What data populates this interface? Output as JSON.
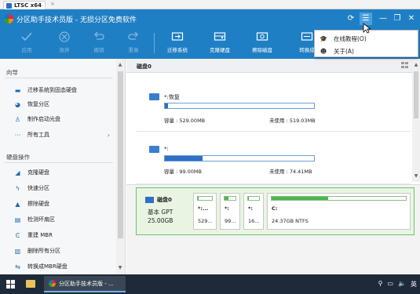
{
  "vm": {
    "tab_label": "LTSC x64",
    "tab_close": "×"
  },
  "window": {
    "title": "分区助手技术员版 - 无损分区免费软件",
    "buttons": {
      "refresh": "⟳",
      "menu": "☰",
      "minimize": "—",
      "maximize": "❐",
      "close": "✕"
    }
  },
  "toolbar": {
    "apply": "应用",
    "discard": "放弃",
    "undo": "撤销",
    "redo": "重做",
    "migrate": "迁移系统",
    "clone_disk": "克隆硬盘",
    "wipe_disk": "擦除磁盘",
    "convert_cut": "转换成"
  },
  "menu": {
    "items": [
      {
        "label": "在线教程(O)",
        "icon": "graduation-cap-icon"
      },
      {
        "label": "关于(A)",
        "icon": "smile-icon"
      }
    ]
  },
  "sidebar": {
    "wizard_title": "向导",
    "wizard_items": [
      {
        "label": "迁移系统到固态硬盘",
        "icon": "migrate-icon"
      },
      {
        "label": "恢复分区",
        "icon": "recover-icon"
      },
      {
        "label": "制作启动光盘",
        "icon": "bootdisk-icon"
      },
      {
        "label": "所有工具",
        "icon": "more-icon",
        "chevron": "›"
      }
    ],
    "disk_ops_title": "硬盘操作",
    "disk_items": [
      {
        "label": "克隆硬盘",
        "icon": "clone-icon"
      },
      {
        "label": "快速分区",
        "icon": "lightning-icon"
      },
      {
        "label": "擦除硬盘",
        "icon": "erase-icon"
      },
      {
        "label": "检测坏扇区",
        "icon": "scan-icon"
      },
      {
        "label": "重建 MBR",
        "icon": "rebuild-icon"
      },
      {
        "label": "删除所有分区",
        "icon": "trash-icon"
      },
      {
        "label": "转换成MBR硬盘",
        "icon": "convert-icon"
      }
    ]
  },
  "main": {
    "disk_label": "磁盘0",
    "partitions": [
      {
        "name": "*:恢复",
        "capacity": "容量 : 529.00MB",
        "free": "未使用 : 519.03MB",
        "used_fraction": 0.02
      },
      {
        "name": "*:",
        "capacity": "容量 : 99.00MB",
        "free": "未使用 : 74.41MB",
        "used_fraction": 0.25
      }
    ]
  },
  "diskmap": {
    "name": "磁盘0",
    "type": "基本 GPT",
    "size": "25.00GB",
    "blocks": [
      {
        "name": "*:...",
        "size": "529...",
        "used_fraction": 0.05
      },
      {
        "name": "*:",
        "size": "99...",
        "used_fraction": 0.35
      },
      {
        "name": "*:",
        "size": "16...",
        "used_fraction": 0.05
      },
      {
        "name": "C:",
        "size": "24.37GB NTFS",
        "used_fraction": 0.42
      }
    ]
  },
  "taskbar": {
    "app_label": "分区助手技术员版 - ...",
    "tray": [
      "⚲",
      "▭",
      "🔈",
      "英"
    ]
  },
  "colors": {
    "accent": "#1f7fc4",
    "partition_fill": "#2f6fc4",
    "disk_green": "#4bb84b"
  }
}
